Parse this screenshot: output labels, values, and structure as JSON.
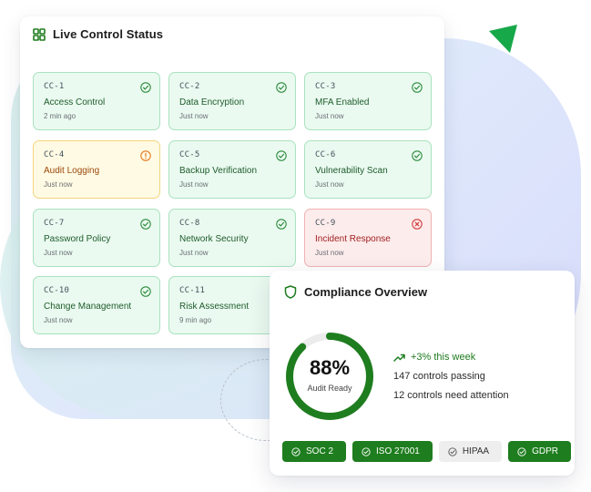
{
  "control_status": {
    "title": "Live Control Status",
    "controls": [
      {
        "code": "CC-1",
        "name": "Access Control",
        "time": "2 min ago",
        "status": "pass"
      },
      {
        "code": "CC-2",
        "name": "Data Encryption",
        "time": "Just now",
        "status": "pass"
      },
      {
        "code": "CC-3",
        "name": "MFA Enabled",
        "time": "Just now",
        "status": "pass"
      },
      {
        "code": "CC-4",
        "name": "Audit Logging",
        "time": "Just now",
        "status": "warning"
      },
      {
        "code": "CC-5",
        "name": "Backup Verification",
        "time": "Just now",
        "status": "pass"
      },
      {
        "code": "CC-6",
        "name": "Vulnerability Scan",
        "time": "Just now",
        "status": "pass"
      },
      {
        "code": "CC-7",
        "name": "Password Policy",
        "time": "Just now",
        "status": "pass"
      },
      {
        "code": "CC-8",
        "name": "Network Security",
        "time": "Just now",
        "status": "pass"
      },
      {
        "code": "CC-9",
        "name": "Incident Response",
        "time": "Just now",
        "status": "fail"
      },
      {
        "code": "CC-10",
        "name": "Change Management",
        "time": "Just now",
        "status": "pass"
      },
      {
        "code": "CC-11",
        "name": "Risk Assessment",
        "time": "9 min ago",
        "status": "pass"
      }
    ]
  },
  "compliance": {
    "title": "Compliance Overview",
    "score": "88%",
    "score_fraction": 0.88,
    "score_label": "Audit Ready",
    "trend": "+3% this week",
    "passing": "147 controls passing",
    "attention": "12 controls need attention",
    "frameworks": [
      {
        "label": "SOC 2",
        "active": true
      },
      {
        "label": "ISO 27001",
        "active": true
      },
      {
        "label": "HIPAA",
        "active": false
      },
      {
        "label": "GDPR",
        "active": true
      }
    ]
  },
  "colors": {
    "pass": "#2e8b3e",
    "warning": "#e07a20",
    "fail": "#d23c3c",
    "brand": "#1e7d1e"
  },
  "icons": {
    "header": "grid-icon",
    "compliance": "shield-icon",
    "trend": "trending-up-icon",
    "pass": "check-circle-icon",
    "warning": "alert-circle-icon",
    "fail": "x-circle-icon"
  }
}
